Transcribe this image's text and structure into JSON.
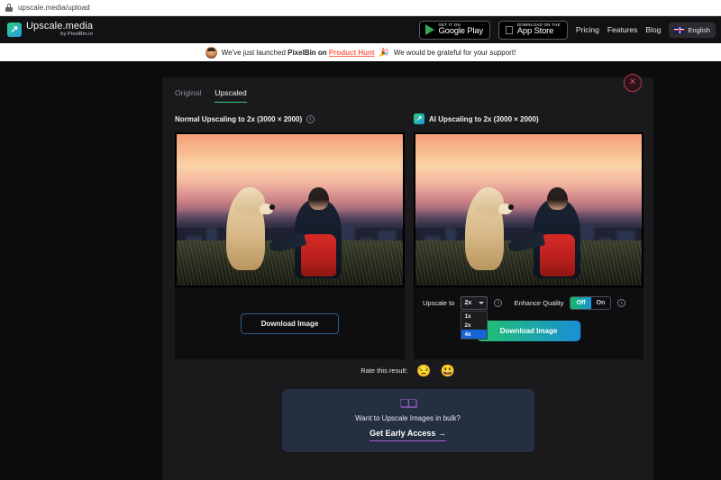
{
  "browser": {
    "url": "upscale.media/upload",
    "lock_icon": "lock-icon"
  },
  "header": {
    "logo_title": "Upscale.media",
    "logo_subtitle": "by PixelBin.io",
    "logo_icon": "upscale-arrow-icon",
    "google_play": {
      "small": "GET IT ON",
      "big": "Google Play",
      "icon": "google-play-icon"
    },
    "app_store": {
      "small": "Download on the",
      "big": "App Store",
      "icon": "apple-icon"
    },
    "nav": [
      "Pricing",
      "Features",
      "Blog"
    ],
    "language": {
      "label": "English",
      "icon": "uk-flag-icon"
    }
  },
  "banner": {
    "avatar_icon": "product-hunt-avatar",
    "text_before": "We've just launched ",
    "bold": "PixelBin on ",
    "link": "Product Hunt",
    "emoji": "🎉",
    "text_after": " We would be grateful for your support!"
  },
  "modal": {
    "close_icon": "close-icon",
    "tabs": [
      {
        "label": "Original",
        "active": false
      },
      {
        "label": "Upscaled",
        "active": true
      }
    ],
    "left_panel": {
      "title": "Normal Upscaling to 2x (3000 × 2000)",
      "info_icon": "info-icon",
      "download_label": "Download Image",
      "image_alt": "man and golden retriever dog at sunset with city skyline"
    },
    "right_panel": {
      "mark_icon": "ai-upscale-icon",
      "title": "AI Upscaling to 2x (3000 × 2000)",
      "image_alt": "man and golden retriever dog at sunset with city skyline",
      "upscale_label": "Upscale to",
      "upscale_value": "2x",
      "upscale_options": [
        "1x",
        "2x",
        "4x"
      ],
      "upscale_highlighted": "4x",
      "upscale_info_icon": "info-icon",
      "enhance_label": "Enhance Quality",
      "enhance_off": "Off",
      "enhance_on": "On",
      "enhance_selected": "Off",
      "enhance_info_icon": "info-icon",
      "download_label": "Download Image",
      "dropdown_icon": "chevron-down-icon"
    },
    "rate": {
      "label": "Rate this result:",
      "emoji_sad": "😒",
      "emoji_happy": "😃"
    },
    "bulk": {
      "icon": "pixelbin-bulk-icon",
      "question": "Want to Upscale Images in bulk?",
      "cta": "Get Early Access →"
    }
  },
  "colors": {
    "accent_green": "#2ecf7a",
    "accent_blue": "#1f9ce8",
    "promo_link": "#ff6154",
    "close_red": "#e0495c",
    "select_highlight": "#1266d6",
    "bulk_card": "#243041"
  }
}
